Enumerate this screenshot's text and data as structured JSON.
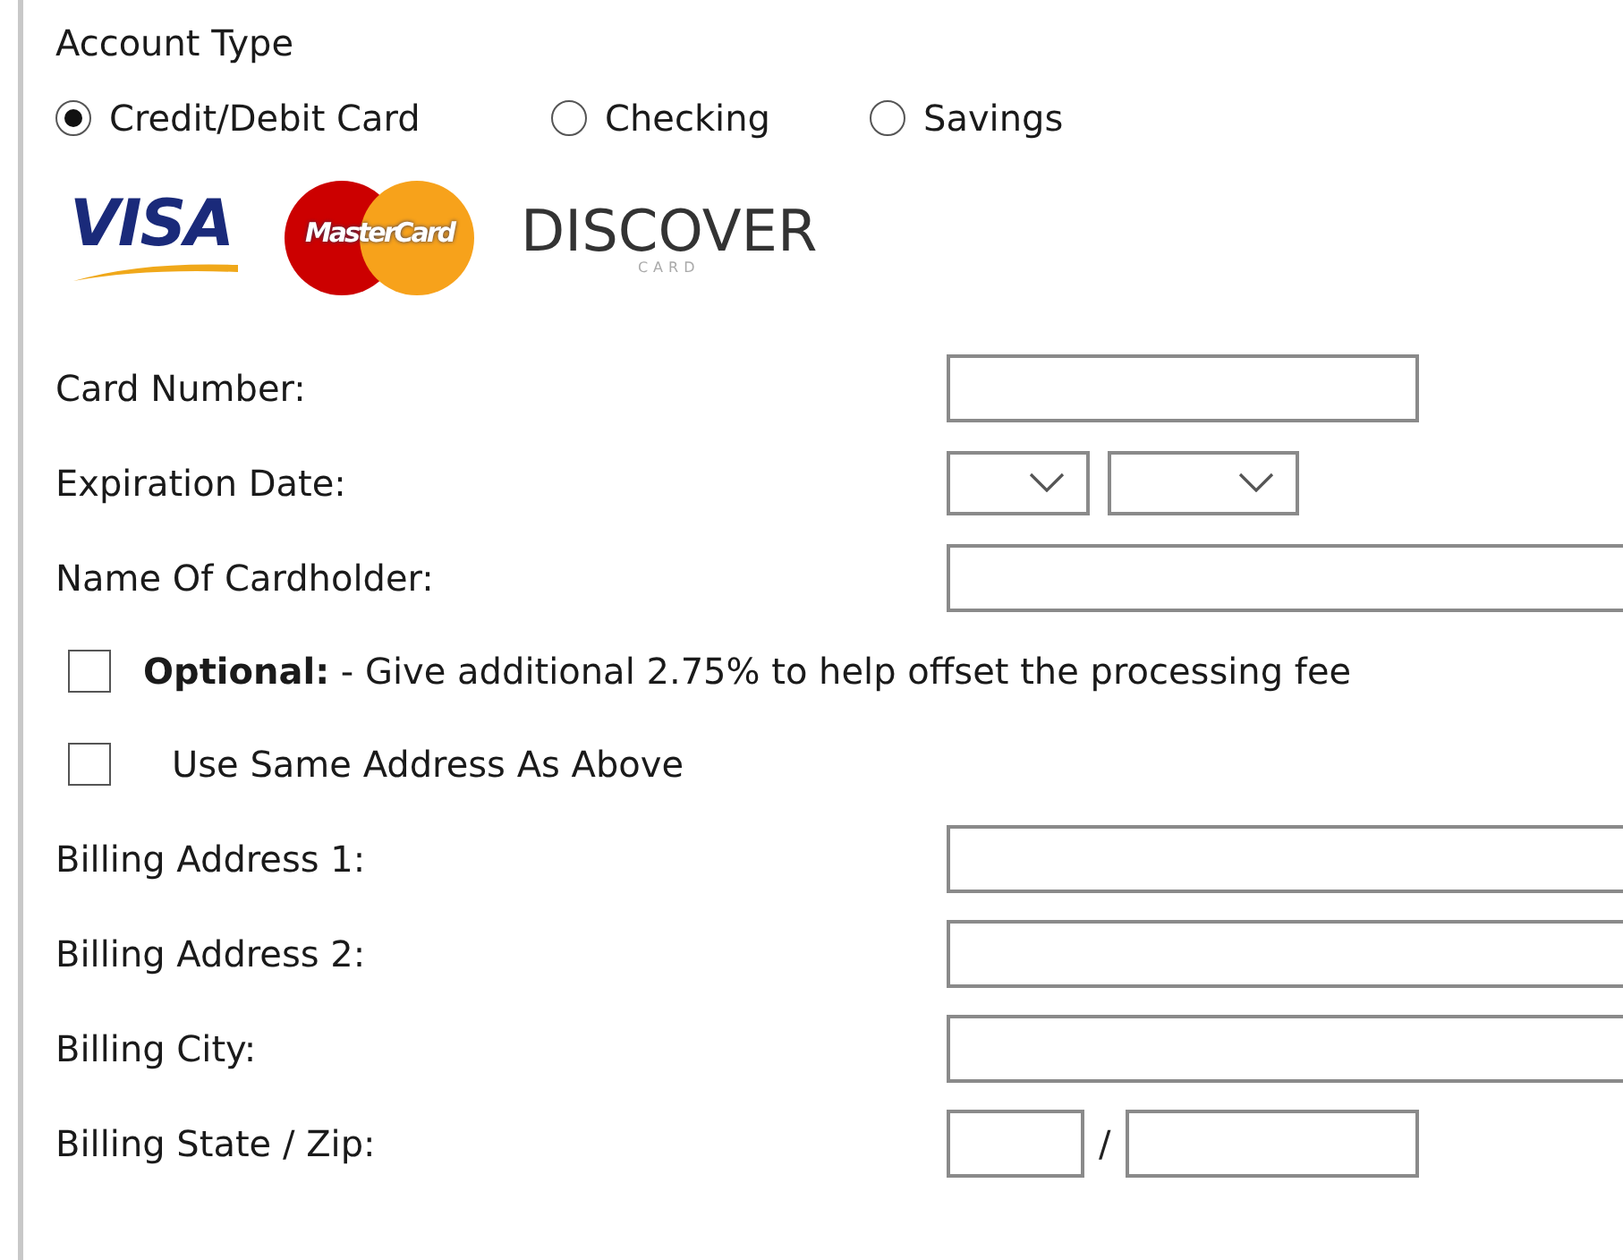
{
  "account_type": {
    "label": "Account Type",
    "options": [
      {
        "label": "Credit/Debit Card",
        "selected": true
      },
      {
        "label": "Checking",
        "selected": false
      },
      {
        "label": "Savings",
        "selected": false
      }
    ]
  },
  "card_logos": [
    {
      "kind": "visa",
      "text": "VISA"
    },
    {
      "kind": "mastercard",
      "text": "MasterCard"
    },
    {
      "kind": "discover",
      "text": "DISCOVER",
      "subtext": "CARD"
    }
  ],
  "rows": [
    {
      "kind": "short",
      "label": "Card Number:"
    },
    {
      "kind": "selects",
      "label": "Expiration Date:"
    },
    {
      "kind": "wide",
      "label": "Name Of Cardholder:"
    },
    {
      "kind": "checkbox",
      "label": "**Optional:** - Give additional 2.75% to help offset the processing fee",
      "checked": false
    },
    {
      "kind": "checkbox",
      "label": "Use Same Address As Above",
      "checked": false
    },
    {
      "kind": "wide",
      "label": "Billing Address 1:"
    },
    {
      "kind": "wide",
      "label": "Billing Address 2:"
    },
    {
      "kind": "wide",
      "label": "Billing City:"
    },
    {
      "kind": "pair",
      "label": "Billing State / Zip:",
      "separator": "/"
    }
  ]
}
